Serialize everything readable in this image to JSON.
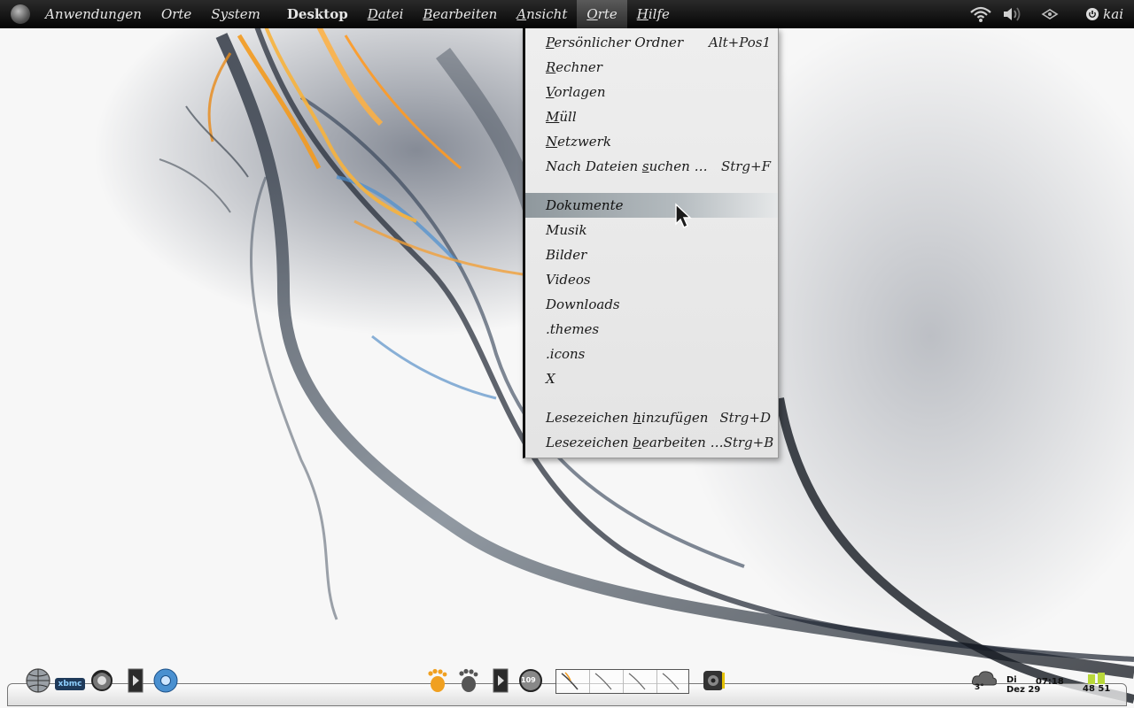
{
  "top_panel": {
    "menus": [
      "Anwendungen",
      "Orte",
      "System"
    ],
    "app_name": "Desktop",
    "app_menus": [
      {
        "pre": "",
        "key": "D",
        "post": "atei"
      },
      {
        "pre": "",
        "key": "B",
        "post": "earbeiten"
      },
      {
        "pre": "",
        "key": "A",
        "post": "nsicht"
      },
      {
        "pre": "",
        "key": "O",
        "post": "rte"
      },
      {
        "pre": "",
        "key": "H",
        "post": "ilfe"
      }
    ],
    "user": "kai"
  },
  "menu": {
    "items": [
      {
        "pre": "",
        "key": "P",
        "post": "ersönlicher Ordner",
        "shortcut": "Alt+Pos1"
      },
      {
        "pre": "",
        "key": "R",
        "post": "echner",
        "shortcut": ""
      },
      {
        "pre": "",
        "key": "V",
        "post": "orlagen",
        "shortcut": ""
      },
      {
        "pre": "",
        "key": "M",
        "post": "üll",
        "shortcut": ""
      },
      {
        "pre": "",
        "key": "N",
        "post": "etzwerk",
        "shortcut": ""
      },
      {
        "pre": "Nach Dateien ",
        "key": "s",
        "post": "uchen …",
        "shortcut": "Strg+F"
      },
      {
        "pre": "Dokumente",
        "key": "",
        "post": "",
        "shortcut": ""
      },
      {
        "pre": "Musik",
        "key": "",
        "post": "",
        "shortcut": ""
      },
      {
        "pre": "Bilder",
        "key": "",
        "post": "",
        "shortcut": ""
      },
      {
        "pre": "Videos",
        "key": "",
        "post": "",
        "shortcut": ""
      },
      {
        "pre": "Downloads",
        "key": "",
        "post": "",
        "shortcut": ""
      },
      {
        "pre": ".themes",
        "key": "",
        "post": "",
        "shortcut": ""
      },
      {
        "pre": ".icons",
        "key": "",
        "post": "",
        "shortcut": ""
      },
      {
        "pre": "X",
        "key": "",
        "post": "",
        "shortcut": ""
      },
      {
        "pre": "Lesezeichen ",
        "key": "h",
        "post": "inzufügen",
        "shortcut": "Strg+D"
      },
      {
        "pre": "Lesezeichen ",
        "key": "b",
        "post": "earbeiten …",
        "shortcut": "Strg+B"
      }
    ]
  },
  "dock": {
    "launcher_label": "xbmc",
    "updates_count": "109",
    "weather_temp": "3°",
    "clock_day": "Di",
    "clock_date": "Dez 29",
    "clock_time": "07:18",
    "cpu_values": "48 51"
  },
  "colors": {
    "panel": "#111111",
    "menu_bg": "#e9e9e9",
    "menu_highlight": "#9aa2a6",
    "flame_orange": "#f39a1e"
  }
}
